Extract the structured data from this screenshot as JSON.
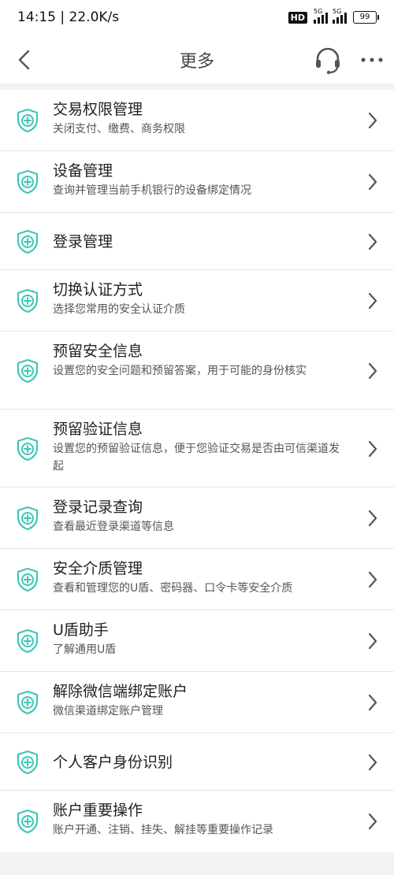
{
  "status": {
    "time": "14:15",
    "speed": "22.0K/s",
    "hd": "HD",
    "net1": "5G",
    "net2": "5G",
    "battery": "99"
  },
  "header": {
    "title": "更多"
  },
  "icons": {
    "back": "chevron-left-icon",
    "service": "headset-icon",
    "more": "more-dots-icon",
    "item": "shield-plus-icon",
    "arrow": "chevron-right-icon"
  },
  "colors": {
    "accent": "#3dc7b8",
    "chevron": "#555555",
    "divider": "#e6e6e6"
  },
  "items": [
    {
      "title": "交易权限管理",
      "subtitle": "关闭支付、缴费、商务权限"
    },
    {
      "title": "设备管理",
      "subtitle": "查询并管理当前手机银行的设备绑定情况"
    },
    {
      "title": "登录管理",
      "subtitle": ""
    },
    {
      "title": "切换认证方式",
      "subtitle": "选择您常用的安全认证介质"
    },
    {
      "title": "预留安全信息",
      "subtitle": "设置您的安全问题和预留答案，用于可能的身份核实"
    },
    {
      "title": "预留验证信息",
      "subtitle": "设置您的预留验证信息，便于您验证交易是否由可信渠道发起"
    },
    {
      "title": "登录记录查询",
      "subtitle": "查看最近登录渠道等信息"
    },
    {
      "title": "安全介质管理",
      "subtitle": "查看和管理您的U盾、密码器、口令卡等安全介质"
    },
    {
      "title": "U盾助手",
      "subtitle": "了解通用U盾"
    },
    {
      "title": "解除微信端绑定账户",
      "subtitle": "微信渠道绑定账户管理"
    },
    {
      "title": "个人客户身份识别",
      "subtitle": ""
    },
    {
      "title": "账户重要操作",
      "subtitle": "账户开通、注销、挂失、解挂等重要操作记录"
    }
  ]
}
